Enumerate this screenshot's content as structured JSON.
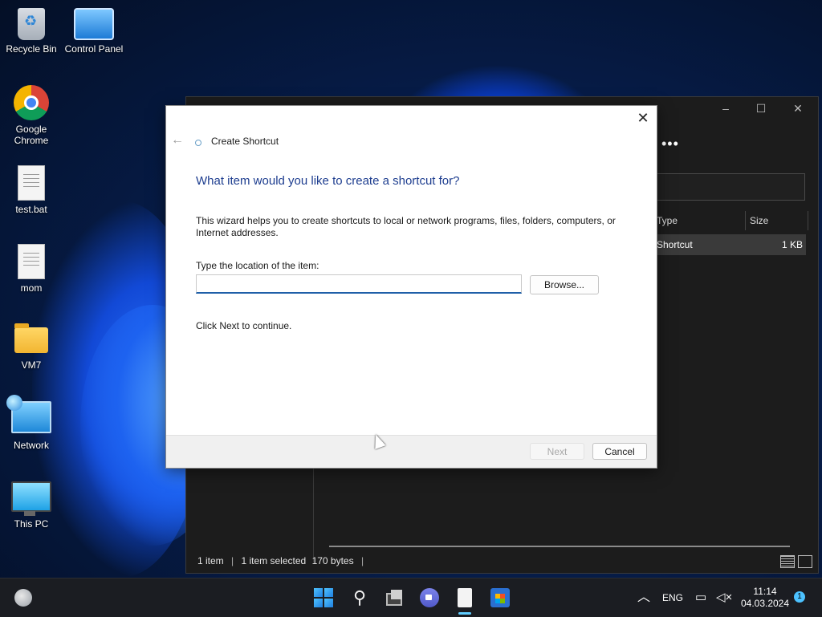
{
  "desktop": {
    "icons": [
      {
        "label": "Recycle Bin",
        "icon": "recycle-bin-icon"
      },
      {
        "label": "Control Panel",
        "icon": "control-panel-icon"
      },
      {
        "label": "Google Chrome",
        "icon": "chrome-icon"
      },
      {
        "label": "test.bat",
        "icon": "batch-file-icon"
      },
      {
        "label": "mom",
        "icon": "text-file-icon"
      },
      {
        "label": "VM7",
        "icon": "folder-icon"
      },
      {
        "label": "Network",
        "icon": "network-icon"
      },
      {
        "label": "This PC",
        "icon": "this-pc-icon"
      }
    ]
  },
  "explorer": {
    "more_label": "•••",
    "columns": {
      "type": "Type",
      "size": "Size"
    },
    "row": {
      "type": "Shortcut",
      "size": "1 KB"
    },
    "status": {
      "items": "1 item",
      "selected": "1 item selected",
      "bytes": "170 bytes"
    }
  },
  "dialog": {
    "title": "Create Shortcut",
    "heading": "What item would you like to create a shortcut for?",
    "description": "This wizard helps you to create shortcuts to local or network programs, files, folders, computers, or Internet addresses.",
    "location_label": "Type the location of the item:",
    "location_value": "",
    "browse_label": "Browse...",
    "continue_text": "Click Next to continue.",
    "next_label": "Next",
    "cancel_label": "Cancel"
  },
  "taskbar": {
    "language": "ENG",
    "time": "11:14",
    "date": "04.03.2024",
    "notification_count": "1"
  },
  "colors": {
    "heading_blue": "#1d3d8f",
    "input_accent": "#1f5fa8",
    "taskbar_bg": "#1b1d22"
  }
}
